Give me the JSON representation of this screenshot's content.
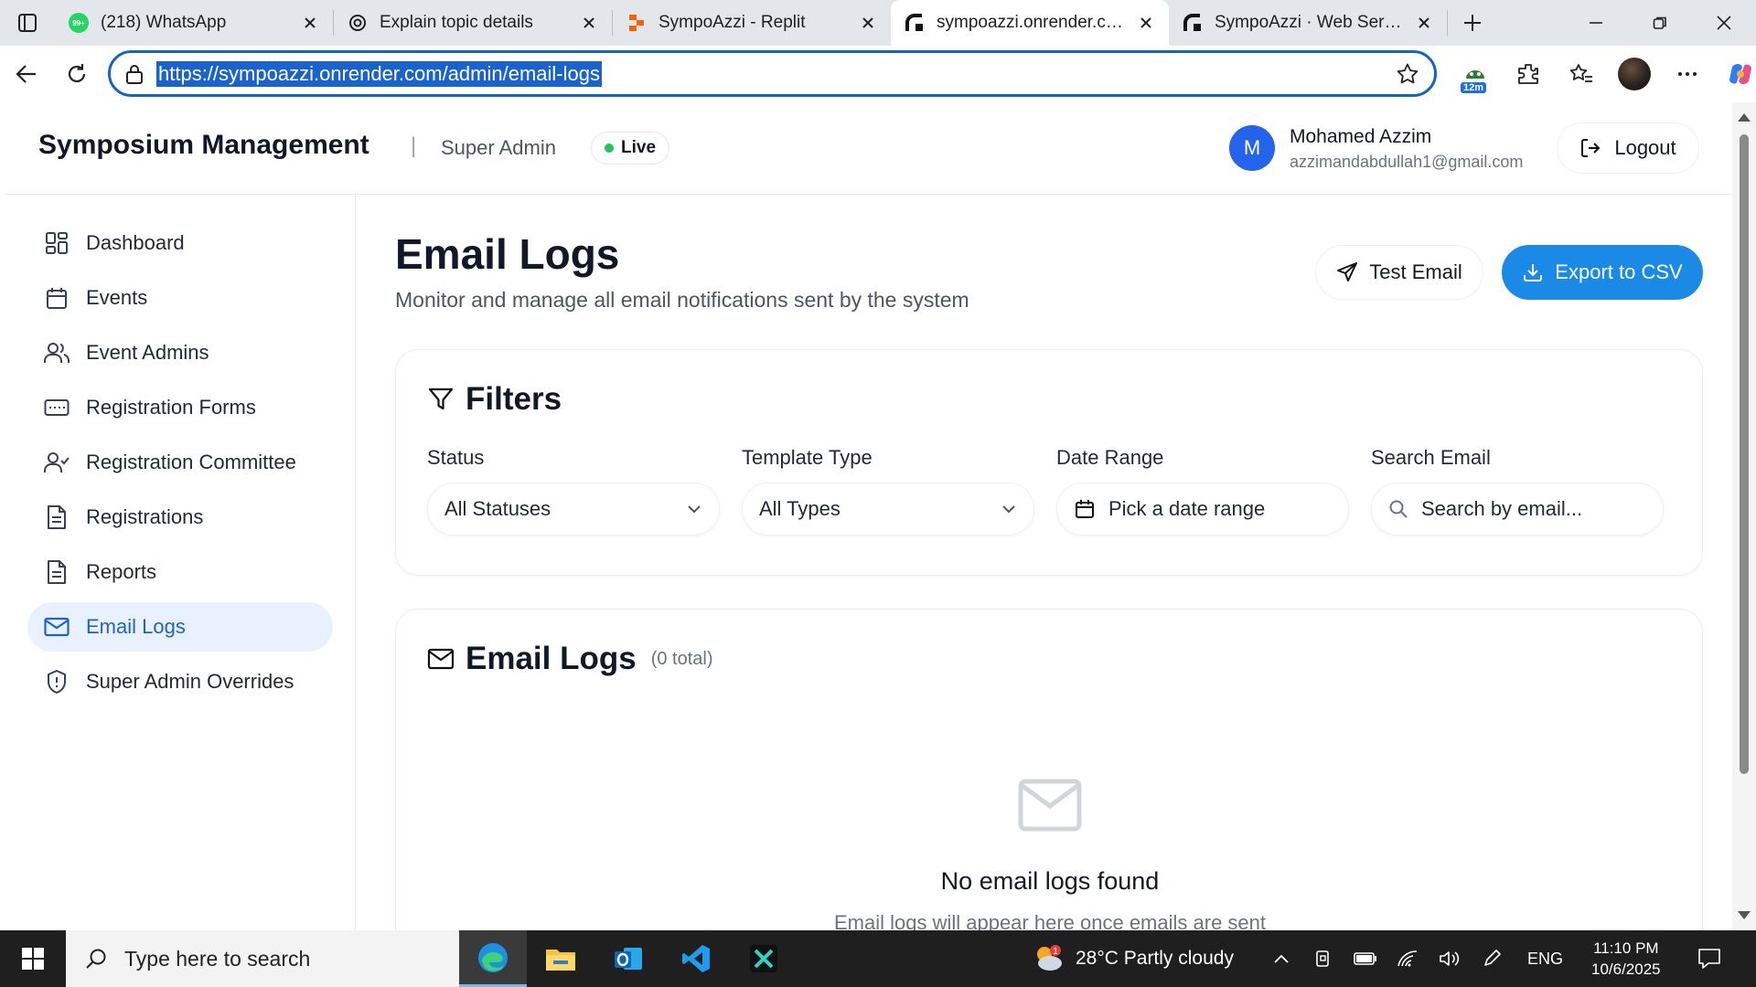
{
  "browser": {
    "tabs": [
      {
        "label": "(218) WhatsApp",
        "icon": "whatsapp-icon",
        "badge": "99+",
        "active": false
      },
      {
        "label": "Explain topic details",
        "icon": "chatgpt-icon",
        "active": false
      },
      {
        "label": "SympoAzzi - Replit",
        "icon": "replit-icon",
        "active": false
      },
      {
        "label": "sympoazzi.onrender.com/a",
        "icon": "render-icon",
        "active": true
      },
      {
        "label": "SympoAzzi · Web Service ·",
        "icon": "render-icon",
        "active": false
      }
    ],
    "url": "https://sympoazzi.onrender.com/admin/email-logs",
    "extension_badge": "12m"
  },
  "header": {
    "brand": "Symposium Management",
    "separator": "|",
    "role": "Super Admin",
    "status": "Live",
    "avatar_initial": "M",
    "user_name": "Mohamed Azzim",
    "user_email": "azzimandabdullah1@gmail.com",
    "logout_label": "Logout"
  },
  "sidebar": {
    "items": [
      {
        "label": "Dashboard",
        "icon": "dashboard-grid-icon",
        "active": false
      },
      {
        "label": "Events",
        "icon": "calendar-icon",
        "active": false
      },
      {
        "label": "Event Admins",
        "icon": "users-icon",
        "active": false
      },
      {
        "label": "Registration Forms",
        "icon": "form-icon",
        "active": false
      },
      {
        "label": "Registration Committee",
        "icon": "user-check-icon",
        "active": false
      },
      {
        "label": "Registrations",
        "icon": "document-icon",
        "active": false
      },
      {
        "label": "Reports",
        "icon": "report-icon",
        "active": false
      },
      {
        "label": "Email Logs",
        "icon": "mail-icon",
        "active": true
      },
      {
        "label": "Super Admin Overrides",
        "icon": "shield-icon",
        "active": false
      }
    ]
  },
  "main": {
    "title": "Email Logs",
    "subtitle": "Monitor and manage all email notifications sent by the system",
    "test_email_label": "Test Email",
    "export_label": "Export to CSV",
    "filters": {
      "title": "Filters",
      "status": {
        "label": "Status",
        "value": "All Statuses"
      },
      "template": {
        "label": "Template Type",
        "value": "All Types"
      },
      "date": {
        "label": "Date Range",
        "placeholder": "Pick a date range"
      },
      "search": {
        "label": "Search Email",
        "placeholder": "Search by email..."
      }
    },
    "logs": {
      "title": "Email Logs",
      "count": "(0 total)",
      "empty_title": "No email logs found",
      "empty_subtitle": "Email logs will appear here once emails are sent"
    }
  },
  "taskbar": {
    "search_placeholder": "Type here to search",
    "weather": "28°C  Partly cloudy",
    "weather_alert": "1",
    "language": "ENG",
    "time": "11:10 PM",
    "date": "10/6/2025"
  },
  "colors": {
    "accent": "#1a8ae6",
    "active_nav_bg": "#e8f1fd",
    "active_nav_text": "#1e63c8",
    "live_dot": "#22c55e",
    "avatar_bg": "#2563eb"
  }
}
